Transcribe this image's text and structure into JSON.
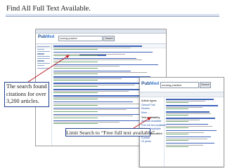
{
  "slide": {
    "title": "Find All Full Text Available."
  },
  "callouts": {
    "left_line1": "The search found",
    "left_line2": "citations for over",
    "left_line3": "3,200 articles.",
    "bottom": "Limit Search to “Free full text available”."
  },
  "screenshot_main": {
    "logo_a": "Pub",
    "logo_b": "Med",
    "search_value": "nursing practice",
    "search_button": "Search"
  },
  "screenshot_limits": {
    "logo_a": "Pub",
    "logo_b": "Med",
    "search_value": "nursing practice",
    "search_button": "Search",
    "sidebar": {
      "section_type": "Article types",
      "items_type": [
        "Clinical Trial",
        "Review",
        "More ..."
      ],
      "section_text": "Text availability",
      "items_text": [
        "Abstract available",
        "Free full text available",
        "Full text available"
      ],
      "section_date": "Publication dates",
      "items_date": [
        "5 years",
        "10 years"
      ]
    }
  },
  "colors": {
    "callout_border": "#1f3f8f",
    "arrow": "#c0141b",
    "link": "#1b4fa8"
  }
}
